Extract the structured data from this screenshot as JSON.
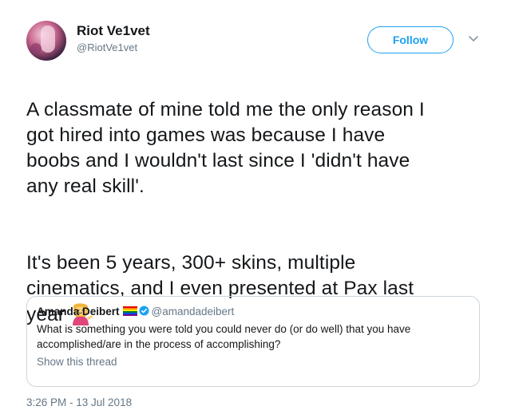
{
  "tweet": {
    "author": {
      "display_name": "Riot Ve1vet",
      "handle": "@RiotVe1vet"
    },
    "follow_label": "Follow",
    "caret_icon": "chevron-down-icon",
    "text_para1": "A classmate of mine told me the only reason I\ngot hired into games was because I have\nboobs and I wouldn't last since I 'didn't have\nany real skill'.",
    "text_para2": "It's been 5 years, 300+ skins, multiple\ncinematics, and I even presented at Pax last\nyear",
    "emoji": "person-tipping-hand-emoji",
    "timestamp": "3:26 PM - 13 Jul 2018"
  },
  "quoted_tweet": {
    "author_name": "Amanda Deibert",
    "badges": [
      "rainbow-flag-icon",
      "verified-icon"
    ],
    "handle": "@amandadeibert",
    "text": "What is something you were told you could never do (or do well) that you have accomplished/are in the process of accomplishing?",
    "show_thread_label": "Show this thread"
  },
  "colors": {
    "accent": "#1da1f2",
    "text": "#14171a",
    "secondary": "#657786",
    "border": "#ccd6dd"
  }
}
